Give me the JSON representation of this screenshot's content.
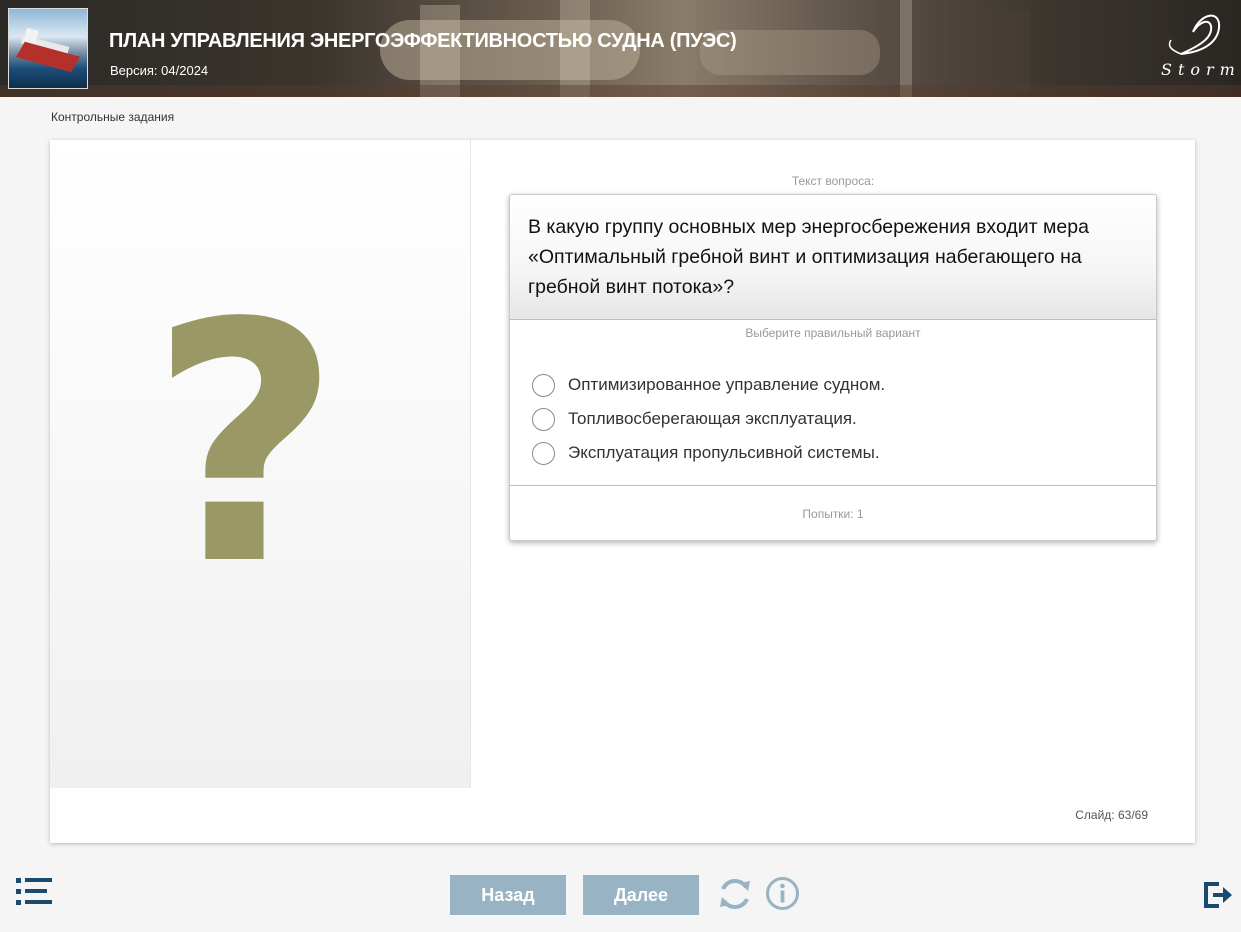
{
  "header": {
    "title": "ПЛАН УПРАВЛЕНИЯ ЭНЕРГОЭФФЕКТИВНОСТЬЮ СУДНА (ПУЭС)",
    "version": "Версия: 04/2024",
    "logo_text": "Storm"
  },
  "breadcrumb": "Контрольные задания",
  "left_panel": {
    "symbol": "?"
  },
  "question": {
    "label": "Текст вопроса:",
    "text": "В какую группу основных мер энергосбережения входит мера «Оптимальный гребной винт и оптимизация набегающего на гребной винт потока»?",
    "instruction": "Выберите правильный вариант",
    "options": [
      {
        "label": "Оптимизированное управление судном."
      },
      {
        "label": "Топливосберегающая эксплуатация."
      },
      {
        "label": "Эксплуатация пропульсивной системы."
      }
    ],
    "attempts": "Попытки: 1"
  },
  "slide_counter": "Слайд: 63/69",
  "nav": {
    "back_label": "Назад",
    "next_label": "Далее"
  },
  "icons": {
    "menu": "list-menu-icon",
    "reload": "reload-icon",
    "info": "info-icon",
    "exit": "exit-icon"
  },
  "colors": {
    "button_bg": "#97b3c4",
    "icon_color": "#1a4a6e",
    "question_mark": "#9a9865"
  }
}
